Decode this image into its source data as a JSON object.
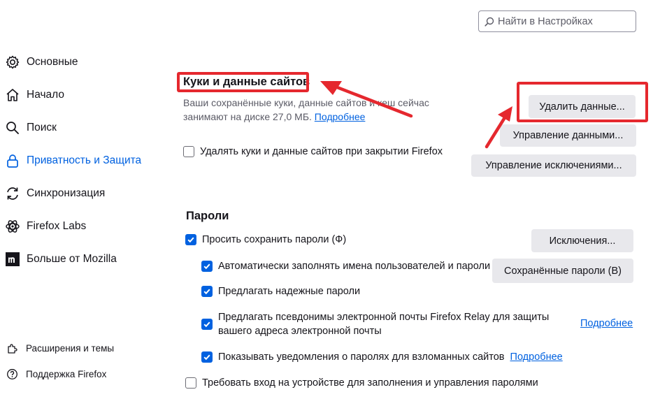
{
  "search": {
    "placeholder": "Найти в Настройках"
  },
  "sidebar": {
    "items": [
      {
        "label": "Основные",
        "icon": "gear-icon"
      },
      {
        "label": "Начало",
        "icon": "home-icon"
      },
      {
        "label": "Поиск",
        "icon": "search-icon"
      },
      {
        "label": "Приватность и Защита",
        "icon": "lock-icon",
        "active": true
      },
      {
        "label": "Синхронизация",
        "icon": "sync-icon"
      },
      {
        "label": "Firefox Labs",
        "icon": "labs-icon"
      },
      {
        "label": "Больше от Mozilla",
        "icon": "mozilla-icon"
      }
    ],
    "footer": [
      {
        "label": "Расширения и темы",
        "icon": "puzzle-icon"
      },
      {
        "label": "Поддержка Firefox",
        "icon": "help-icon"
      }
    ]
  },
  "cookies": {
    "heading": "Куки и данные сайтов",
    "desc": "Ваши сохранённые куки, данные сайтов и кеш сейчас занимают на диске 27,0 МБ.",
    "learn_more": "Подробнее",
    "clear_button": "Удалить данные...",
    "manage_button": "Управление данными...",
    "exceptions_button": "Управление исключениями...",
    "delete_on_close": {
      "label": "Удалять куки и данные сайтов при закрытии Firefox",
      "checked": false
    }
  },
  "passwords": {
    "heading": "Пароли",
    "ask_save": {
      "label": "Просить сохранить пароли (Ф)",
      "checked": true
    },
    "exceptions_button": "Исключения...",
    "saved_button": "Сохранённые пароли (В)",
    "autofill": {
      "label": "Автоматически заполнять имена пользователей и пароли",
      "checked": true
    },
    "suggest_strong": {
      "label": "Предлагать надежные пароли",
      "checked": true
    },
    "relay": {
      "label": "Предлагать псевдонимы электронной почты Firefox Relay для защиты вашего адреса электронной почты",
      "checked": true
    },
    "relay_learn_more": "Подробнее",
    "breach_alerts": {
      "label": "Показывать уведомления о паролях для взломанных сайтов",
      "checked": true
    },
    "breach_learn_more": "Подробнее",
    "require_device_signin": {
      "label": "Требовать вход на устройстве для заполнения и управления паролями",
      "checked": false
    }
  },
  "colors": {
    "accent": "#0061e0",
    "annotation": "#e5282e",
    "button_bg": "#e8e8ec"
  }
}
